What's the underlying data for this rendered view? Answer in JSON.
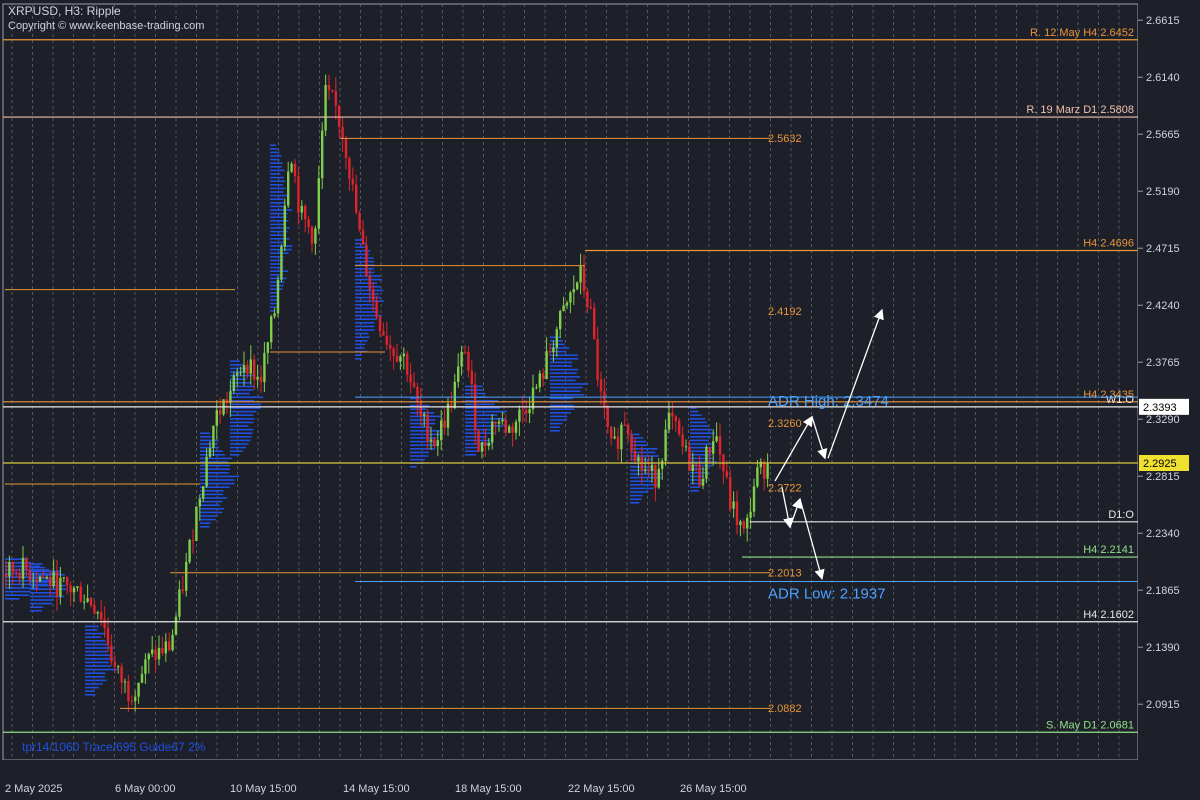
{
  "header": {
    "symbol_line": "XRPUSD, H3:  Ripple",
    "copyright": "Copyright © www.keenbase-trading.com"
  },
  "colors": {
    "background": "#1e2029",
    "grid": "#6a6e78",
    "up_candle": "#7fcf4a",
    "down_candle": "#e0242b",
    "volume_profile": "#1f4fe0",
    "orange_level": "#e8943a",
    "white_level": "#e8e8e8",
    "adr": "#4aa3ff",
    "green_level": "#8fe08a",
    "yellow_level": "#d9c83a"
  },
  "chart_data": {
    "type": "candlestick",
    "ylim": [
      2.045,
      2.675
    ],
    "price_ticks": [
      "2.6615",
      "2.6140",
      "2.5665",
      "2.5190",
      "2.4715",
      "2.4240",
      "2.3765",
      "2.3290",
      "2.2815",
      "2.2340",
      "2.1865",
      "2.1390",
      "2.0915"
    ],
    "date_ticks": [
      "2 May 2025",
      "6 May 00:00",
      "10 May 15:00",
      "14 May 15:00",
      "18 May 15:00",
      "22 May 15:00",
      "26 May 15:00"
    ],
    "levels": [
      {
        "price": 2.6452,
        "label": "R. 12 May H4 2.6452",
        "color": "#e8943a"
      },
      {
        "price": 2.5808,
        "label": "R. 19 Marz D1 2.5808",
        "color": "#f0c0b0"
      },
      {
        "price": 2.4696,
        "label": "H4 2.4696",
        "color": "#e8943a"
      },
      {
        "price": 2.3435,
        "label": "H4 2.3435",
        "color": "#e8943a"
      },
      {
        "price": 2.3393,
        "label": "W1:O",
        "color": "#e8e8e8"
      },
      {
        "price": 2.2925,
        "label": "",
        "color": "#d9c83a"
      },
      {
        "price": 2.2435,
        "label": "D1:O",
        "color": "#e8e8e8"
      },
      {
        "price": 2.2141,
        "label": "H4 2.2141",
        "color": "#8fe08a"
      },
      {
        "price": 2.1602,
        "label": "H4 2.1602",
        "color": "#e8e8e8"
      },
      {
        "price": 2.0681,
        "label": "S. May D1 2.0681",
        "color": "#8fe08a"
      }
    ],
    "price_boxes": [
      {
        "price": 2.3393,
        "label": "2.3393"
      },
      {
        "price": 2.2925,
        "label": "2.2925"
      }
    ],
    "fib_levels": [
      {
        "price": 2.5632,
        "label": "2.5632"
      },
      {
        "price": 2.4192,
        "label": "2.4192"
      },
      {
        "price": 2.326,
        "label": "2.3260"
      },
      {
        "price": 2.2722,
        "label": "2.2722"
      },
      {
        "price": 2.2013,
        "label": "2.2013"
      },
      {
        "price": 2.0882,
        "label": "2.0882"
      }
    ],
    "adr": {
      "high": 2.3474,
      "high_label": "ADR High: 2.3474",
      "low": 2.1937,
      "low_label": "ADR Low: 2.1937"
    },
    "projection_arrows": [
      [
        [
          2.2775,
          2.331
        ],
        [
          2.331,
          2.2965
        ]
      ],
      [
        [
          2.2965,
          2.42
        ]
      ],
      [
        [
          2.2722,
          2.239
        ],
        [
          2.239,
          2.2625
        ]
      ],
      [
        [
          2.2625,
          2.196
        ]
      ]
    ],
    "bottom_left_text": "tpr14/1060 Trace/695 Guide67 2%"
  }
}
